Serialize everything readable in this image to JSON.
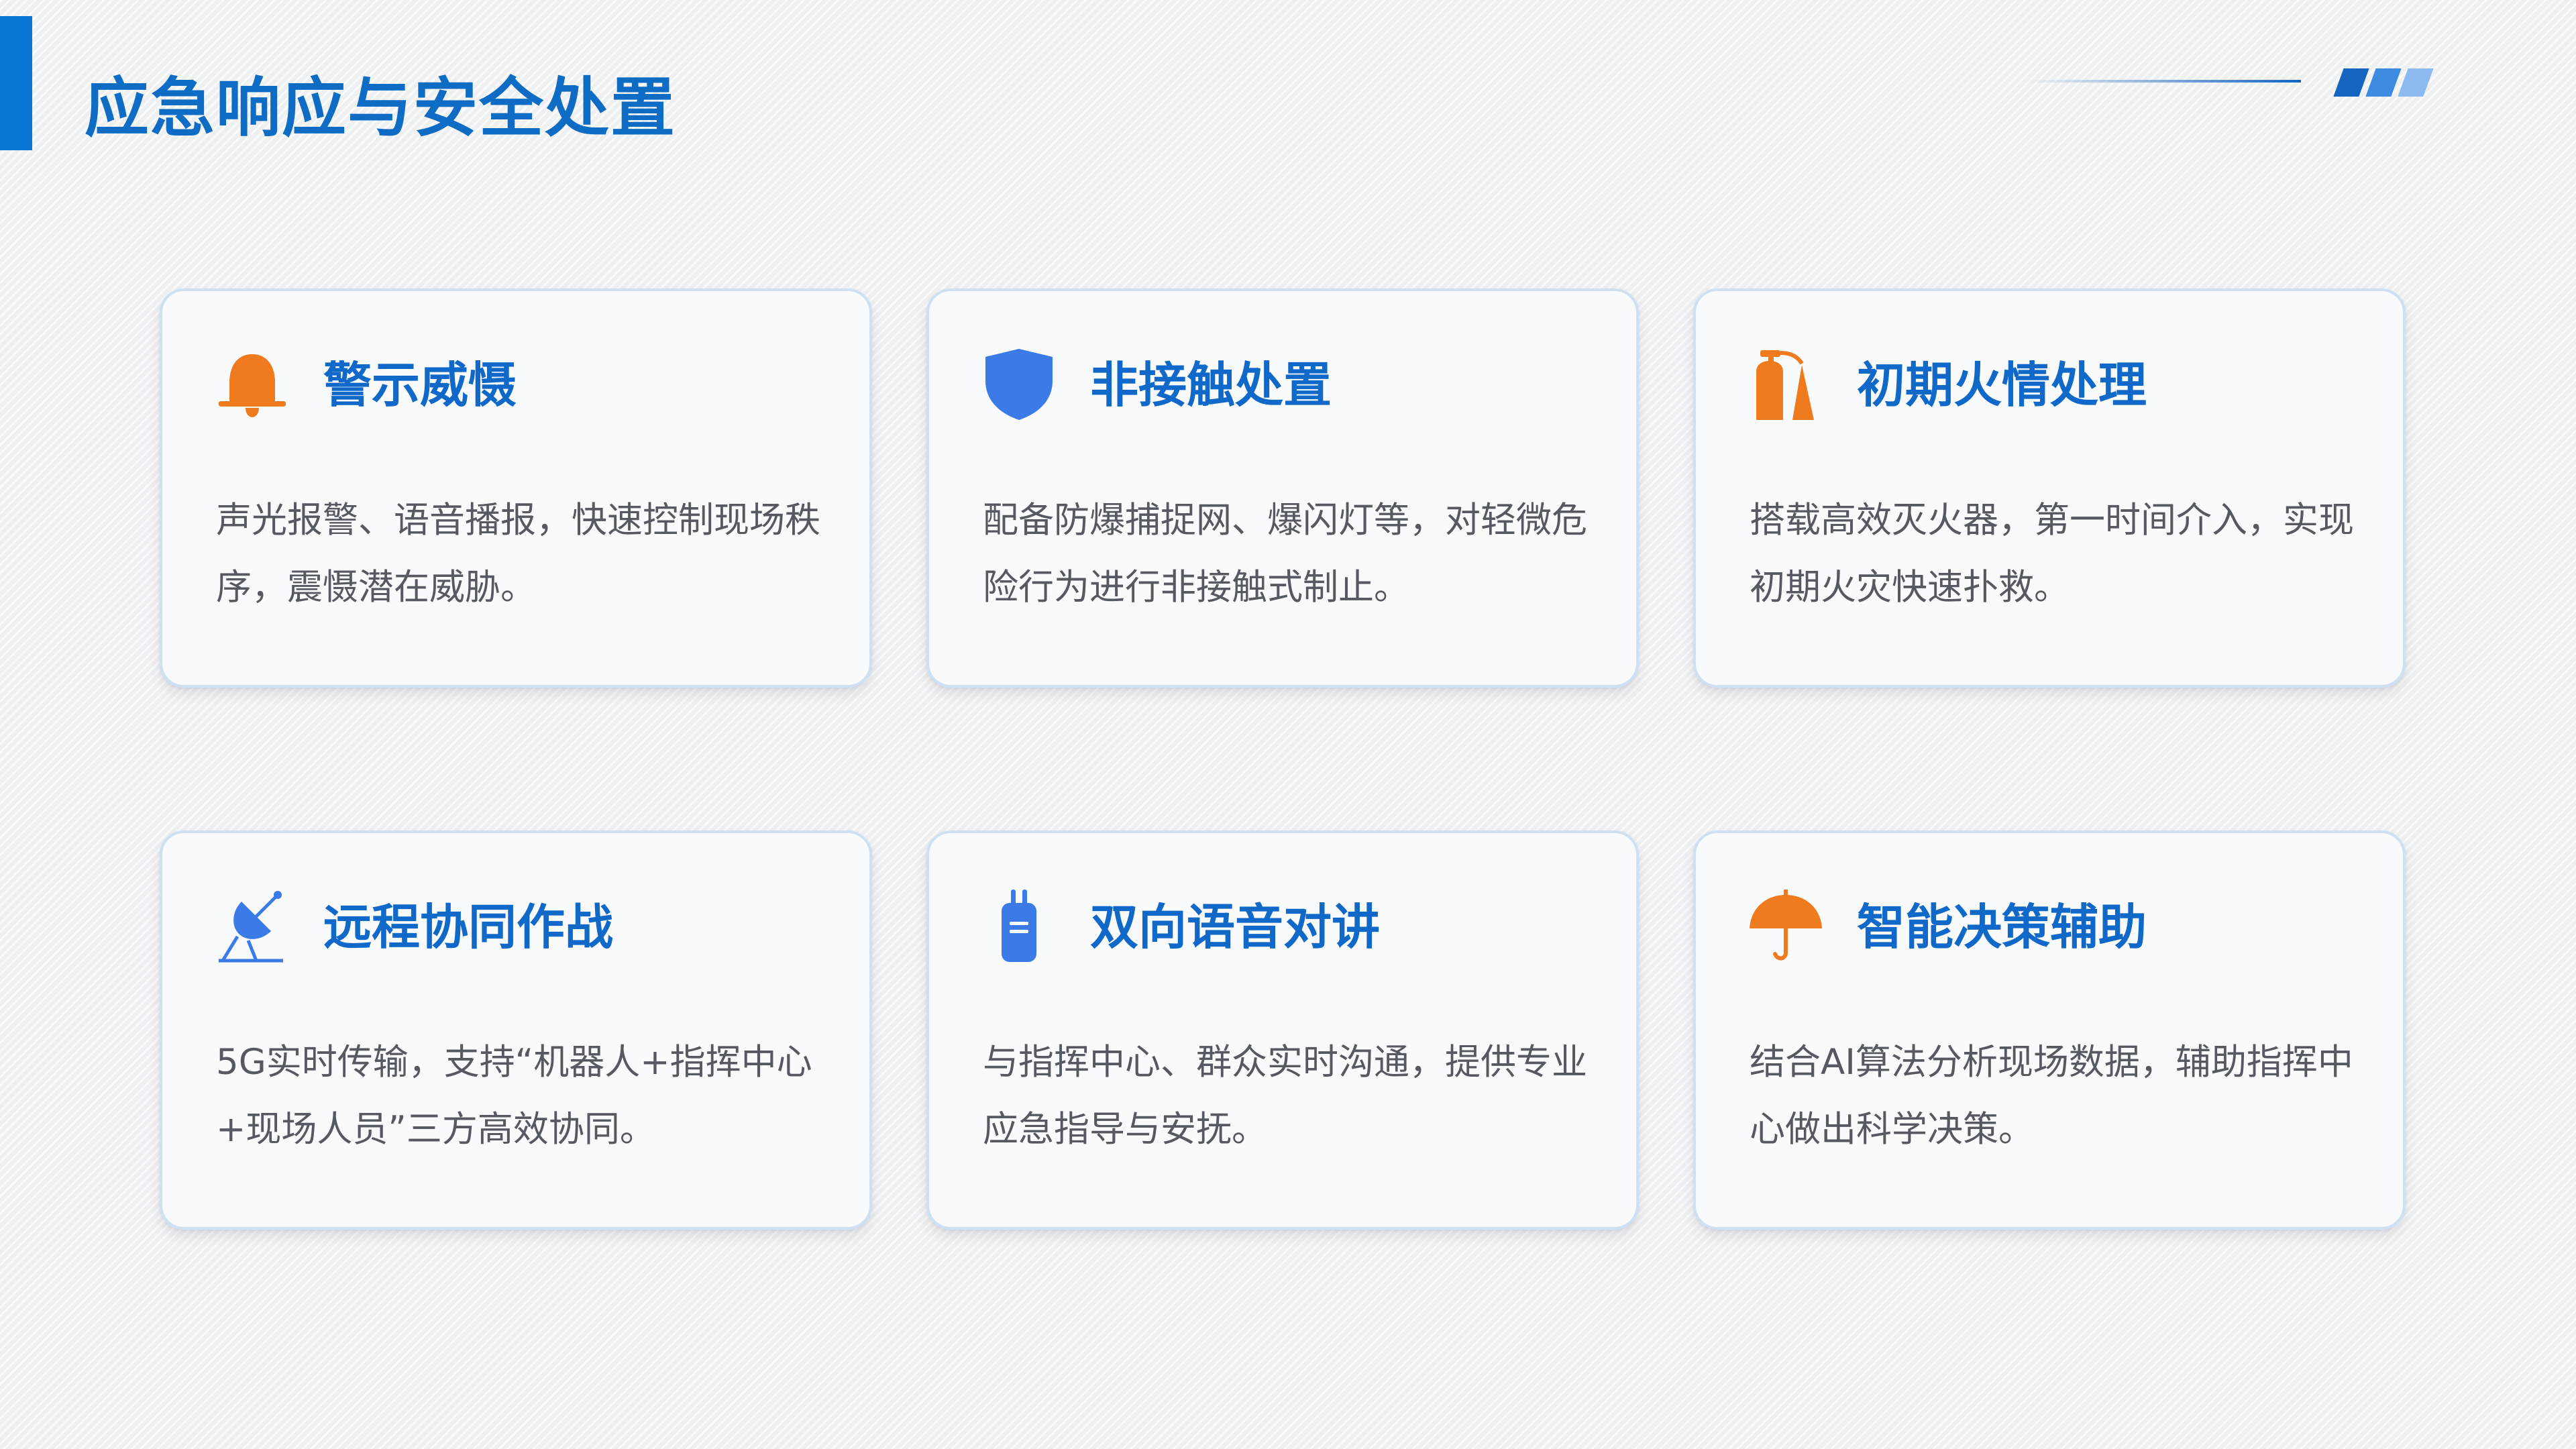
{
  "page": {
    "title": "应急响应与安全处置"
  },
  "colors": {
    "accent_blue": "#0a78d2",
    "title_blue": "#1068c8",
    "icon_orange": "#f07a1e",
    "icon_blue": "#3a7be8",
    "text_gray": "#555a62"
  },
  "cards": [
    {
      "icon": "alarm-bell-icon",
      "title": "警示威慑",
      "description": "声光报警、语音播报，快速控制现场秩序，震慑潜在威胁。"
    },
    {
      "icon": "shield-icon",
      "title": "非接触处置",
      "description": "配备防爆捕捉网、爆闪灯等，对轻微危险行为进行非接触式制止。"
    },
    {
      "icon": "fire-extinguisher-icon",
      "title": "初期火情处理",
      "description": "搭载高效灭火器，第一时间介入，实现初期火灾快速扑救。"
    },
    {
      "icon": "satellite-dish-icon",
      "title": "远程协同作战",
      "description": "5G实时传输，支持“机器人+指挥中心+现场人员”三方高效协同。"
    },
    {
      "icon": "walkie-talkie-icon",
      "title": "双向语音对讲",
      "description": "与指挥中心、群众实时沟通，提供专业应急指导与安抚。"
    },
    {
      "icon": "umbrella-icon",
      "title": "智能决策辅助",
      "description": "结合AI算法分析现场数据，辅助指挥中心做出科学决策。"
    }
  ]
}
